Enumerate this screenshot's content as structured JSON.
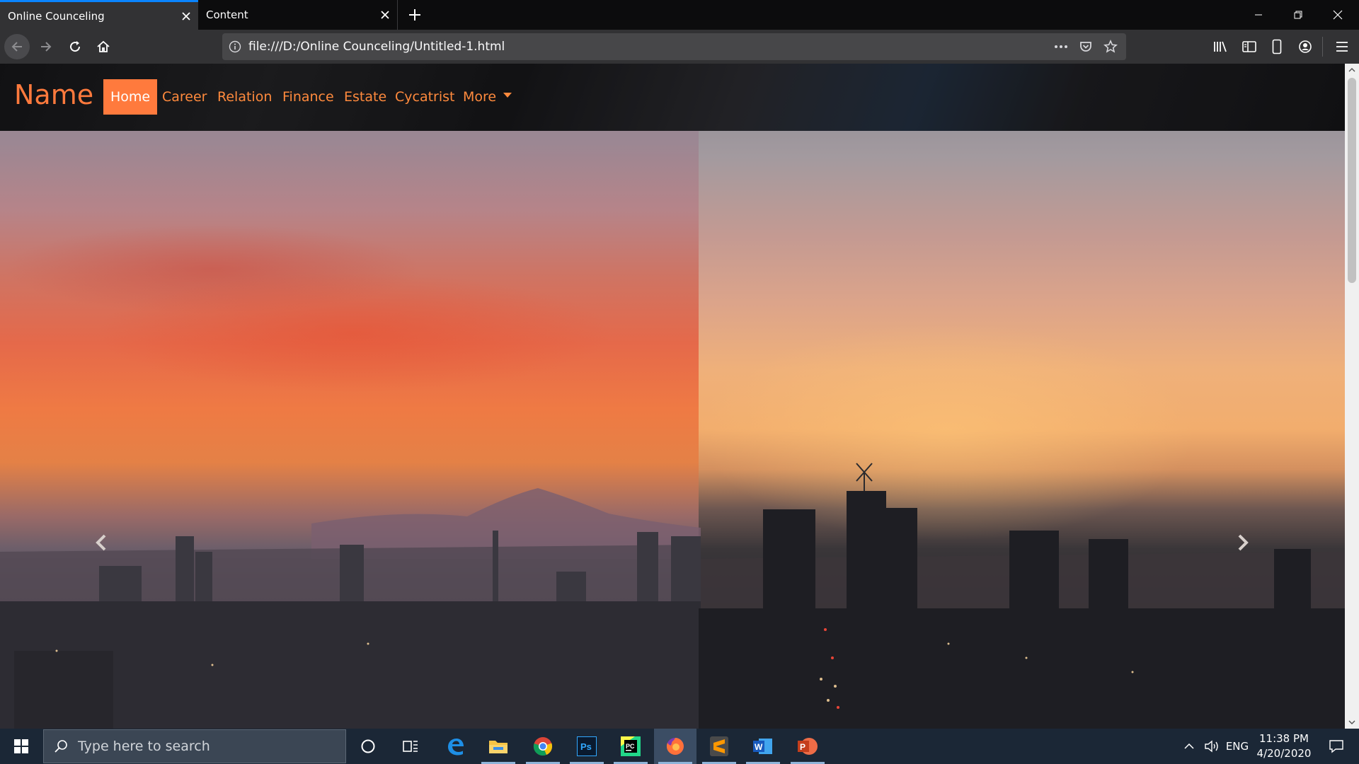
{
  "browser": {
    "tabs": [
      {
        "label": "Online Counceling",
        "active": true
      },
      {
        "label": "Content",
        "active": false
      }
    ],
    "url": "file:///D:/Online Counceling/Untitled-1.html",
    "accent": "#0a84ff"
  },
  "site": {
    "brand": "Name",
    "nav": [
      {
        "label": "Home",
        "active": true
      },
      {
        "label": "Career"
      },
      {
        "label": "Relation"
      },
      {
        "label": "Finance"
      },
      {
        "label": "Estate"
      },
      {
        "label": "Cycatrist"
      },
      {
        "label": "More",
        "dropdown": true
      }
    ],
    "accent_color": "#ff7a3d",
    "carousel": {
      "prev_icon": "chevron-left-icon",
      "next_icon": "chevron-right-icon",
      "slides": [
        "sunset-cityscape-red-sky",
        "sunset-cityscape-golden-sky"
      ]
    }
  },
  "taskbar": {
    "search_placeholder": "Type here to search",
    "apps": [
      "cortana-icon",
      "task-view-icon",
      "edge-icon",
      "file-explorer-icon",
      "chrome-icon",
      "photoshop-icon",
      "pycharm-icon",
      "firefox-icon",
      "sublime-text-icon",
      "word-icon",
      "powerpoint-icon"
    ],
    "language": "ENG",
    "time": "11:38 PM",
    "date": "4/20/2020"
  }
}
